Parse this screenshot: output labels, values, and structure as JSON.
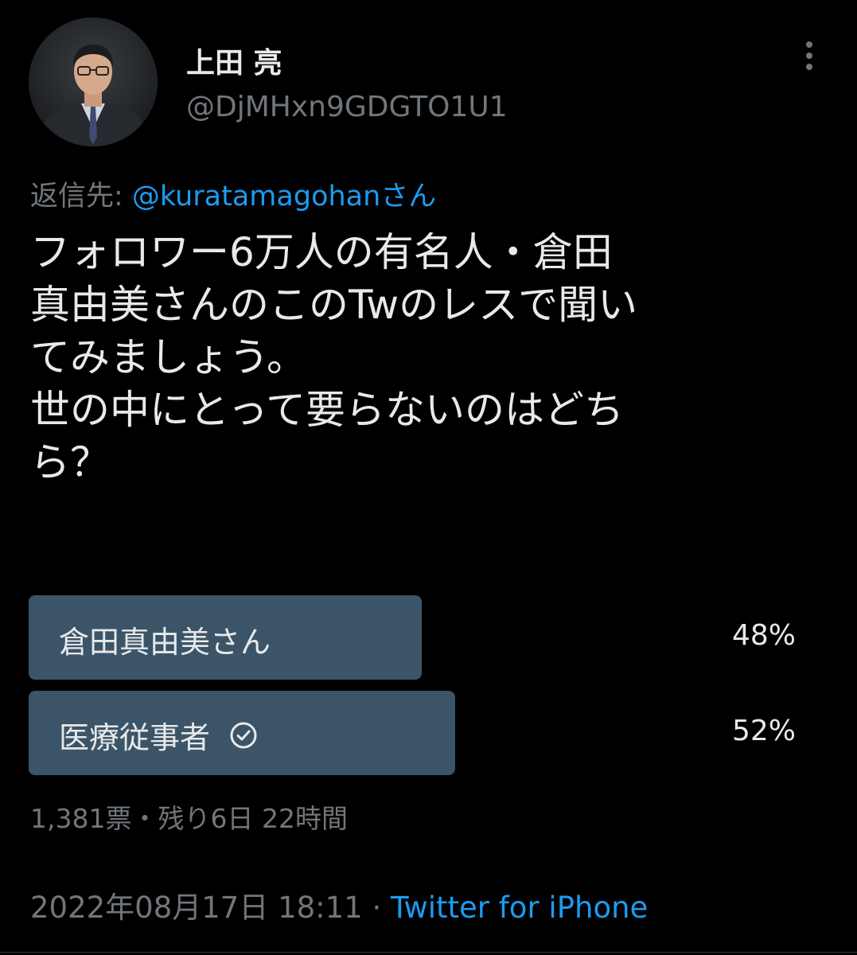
{
  "author": {
    "name": "上田 亮",
    "handle": "@DjMHxn9GDGTO1U1",
    "avatar_icon": "profile-photo"
  },
  "header": {
    "more_icon": "more-vertical-icon"
  },
  "reply": {
    "prefix": "返信先: ",
    "user": "@kuratamagohanさん"
  },
  "tweet": {
    "lines": [
      "フォロワー6万人の有名人・倉田",
      "真由美さんのこのTwのレスで聞い",
      "てみましょう。",
      "世の中にとって要らないのはどち",
      "ら？"
    ]
  },
  "poll": {
    "options": [
      {
        "label": "倉田真由美さん",
        "percent_text": "48%",
        "value": 48,
        "selected": false
      },
      {
        "label": "医療従事者",
        "percent_text": "52%",
        "value": 52,
        "selected": true
      }
    ],
    "meta": "1,381票・残り6日 22時間"
  },
  "footer": {
    "timestamp": "2022年08月17日 18:11",
    "separator": "·",
    "source": "Twitter for iPhone"
  },
  "colors": {
    "background": "#000000",
    "text_primary": "#e7e9ea",
    "text_secondary": "#71767b",
    "link": "#1d9bf0",
    "poll_bar": "#3b5468"
  }
}
